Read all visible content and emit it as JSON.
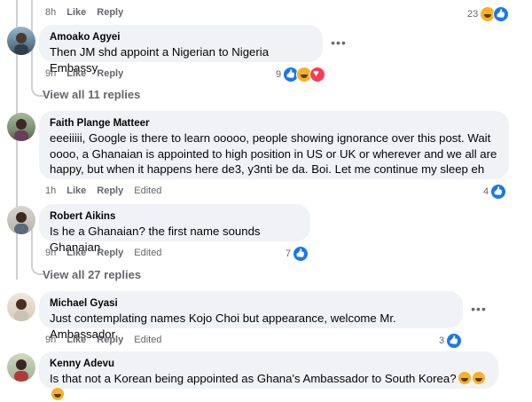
{
  "top_meta": {
    "time": "8h",
    "like": "Like",
    "reply": "Reply",
    "react_count": "23"
  },
  "comments": [
    {
      "author": "Amoako Agyei",
      "text": "Then JM shd appoint a Nigerian to Nigeria Embassy.",
      "time": "9h",
      "like": "Like",
      "reply": "Reply",
      "react_count": "9",
      "reactions": [
        "like-icon",
        "haha-icon",
        "love-icon"
      ]
    },
    {
      "author": "Faith Plange Matteer",
      "text": "eeeiiiii, Google is there to learn ooooo, people showing ignorance over this post. Wait oooo, a Ghanaian is appointed to high position in US or UK or wherever and we all are happy, but when it happens here de3, y3nti be da. Boi. Let me continue my sleep eh",
      "time": "1h",
      "like": "Like",
      "reply": "Reply",
      "edited": "Edited",
      "react_count": "4",
      "reactions": [
        "like-icon"
      ]
    },
    {
      "author": "Robert Aikins",
      "text": "Is he a Ghanaian? the first name sounds Ghanaian",
      "time": "9h",
      "like": "Like",
      "reply": "Reply",
      "edited": "Edited",
      "react_count": "7",
      "reactions": [
        "like-icon"
      ]
    },
    {
      "author": "Michael Gyasi",
      "text": "Just contemplating names Kojo Choi but appearance, welcome Mr. Ambassador",
      "time": "9h",
      "like": "Like",
      "reply": "Reply",
      "edited": "Edited",
      "react_count": "3",
      "reactions": [
        "like-icon"
      ]
    },
    {
      "author": "Kenny Adevu",
      "text": "Is that not a Korean being appointed as Ghana's Ambassador to South Korea?"
    }
  ],
  "view_replies": [
    "View all 11 replies",
    "View all 27 replies"
  ],
  "more_label": "•••",
  "colors": {
    "bubble": "#f0f2f5",
    "meta": "#65676b",
    "like_blue": "#1877f2",
    "thread": "#ced0d4"
  }
}
